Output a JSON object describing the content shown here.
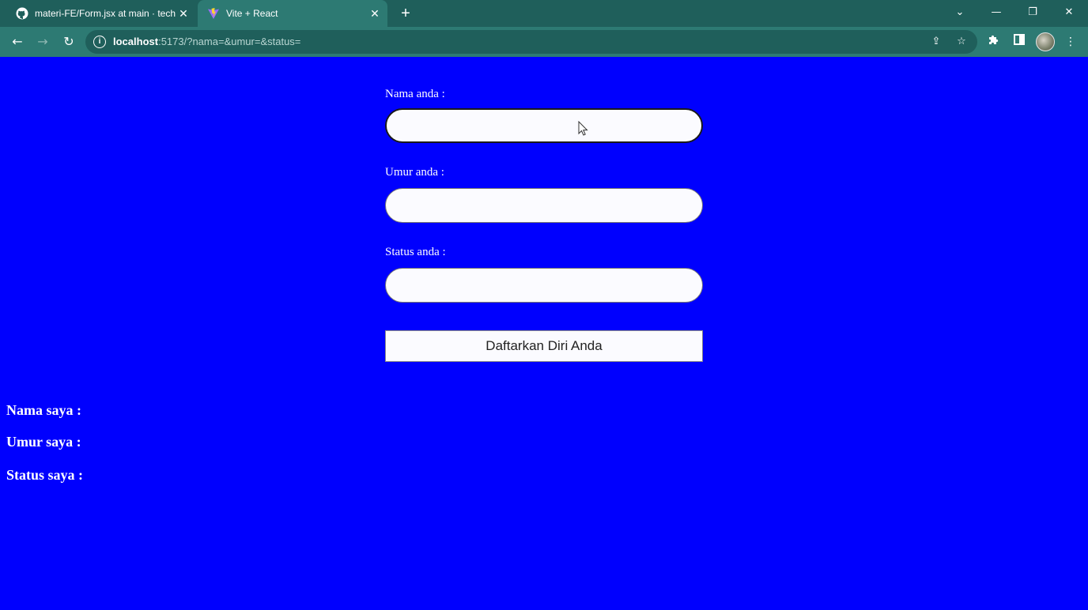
{
  "browser": {
    "tabs": [
      {
        "title": "materi-FE/Form.jsx at main · tech",
        "icon": "github-icon",
        "active": false
      },
      {
        "title": "Vite + React",
        "icon": "vite-icon",
        "active": true
      }
    ],
    "new_tab_label": "+",
    "url_host": "localhost",
    "url_path": ":5173/?nama=&umur=&status=",
    "window_controls": {
      "minimize": "—",
      "restore": "❐",
      "close": "✕"
    }
  },
  "form": {
    "nama_label": "Nama anda :",
    "nama_value": "",
    "umur_label": "Umur anda :",
    "umur_value": "",
    "status_label": "Status anda :",
    "status_value": "",
    "submit_label": "Daftarkan Diri Anda"
  },
  "output": {
    "nama": "Nama saya :",
    "umur": "Umur saya :",
    "status": "Status saya :"
  },
  "colors": {
    "page_background": "#0000fe",
    "browser_frame": "#1f5f5b",
    "toolbar": "#2d7a73"
  }
}
